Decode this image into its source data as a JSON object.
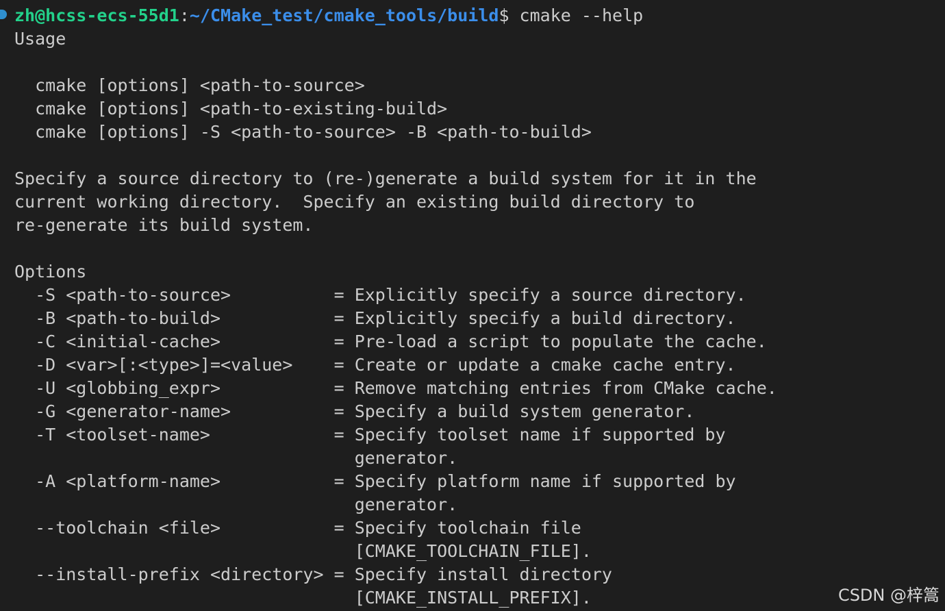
{
  "prompt": {
    "user_host": "zh@hcss-ecs-55d1",
    "separator": ":",
    "cwd": "~/CMake_test/cmake_tools/build",
    "symbol": "$",
    "command": " cmake --help"
  },
  "output_lines": [
    "Usage",
    "",
    "  cmake [options] <path-to-source>",
    "  cmake [options] <path-to-existing-build>",
    "  cmake [options] -S <path-to-source> -B <path-to-build>",
    "",
    "Specify a source directory to (re-)generate a build system for it in the",
    "current working directory.  Specify an existing build directory to",
    "re-generate its build system.",
    "",
    "Options",
    "  -S <path-to-source>          = Explicitly specify a source directory.",
    "  -B <path-to-build>           = Explicitly specify a build directory.",
    "  -C <initial-cache>           = Pre-load a script to populate the cache.",
    "  -D <var>[:<type>]=<value>    = Create or update a cmake cache entry.",
    "  -U <globbing_expr>           = Remove matching entries from CMake cache.",
    "  -G <generator-name>          = Specify a build system generator.",
    "  -T <toolset-name>            = Specify toolset name if supported by",
    "                                 generator.",
    "  -A <platform-name>           = Specify platform name if supported by",
    "                                 generator.",
    "  --toolchain <file>           = Specify toolchain file",
    "                                 [CMAKE_TOOLCHAIN_FILE].",
    "  --install-prefix <directory> = Specify install directory",
    "                                 [CMAKE_INSTALL_PREFIX]."
  ],
  "watermark": "CSDN @梓篙",
  "colors": {
    "background": "#1e1e1e",
    "text": "#cccccc",
    "user_host": "#23d18b",
    "cwd": "#3b8eea",
    "prompt_marker": "#2f8fcf"
  }
}
